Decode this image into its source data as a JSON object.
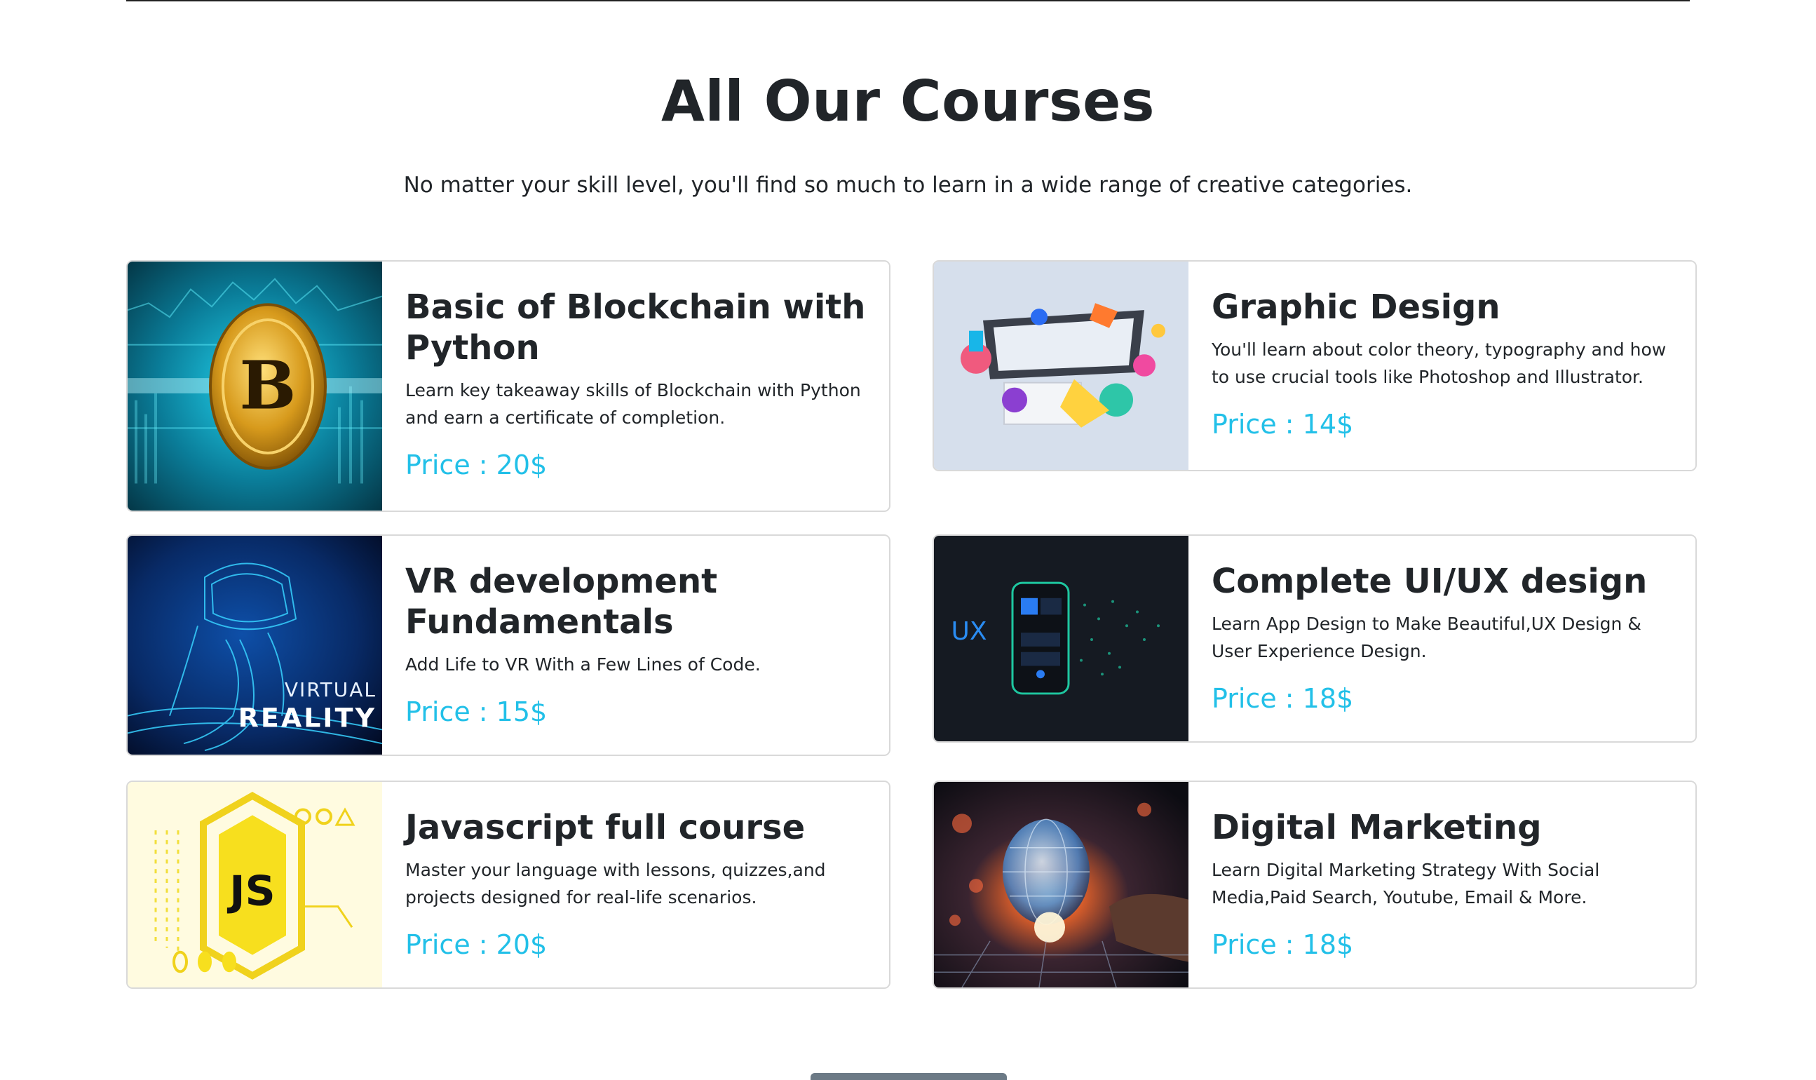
{
  "section": {
    "title": "All Our Courses",
    "subtitle": "No matter your skill level, you'll find so much to learn in a wide range of creative categories."
  },
  "accent_color": "#22c0e8",
  "courses": [
    {
      "title": "Basic of Blockchain with Python",
      "description": "Learn key takeaway skills of Blockchain with Python and earn a certificate of completion.",
      "price": "Price : 20$",
      "image_icon": "bitcoin-image",
      "image_text": "B"
    },
    {
      "title": "Graphic Design",
      "description": "You'll learn about color theory, typography and how to use crucial tools like Photoshop and Illustrator.",
      "price": "Price : 14$",
      "image_icon": "graphic-design-image"
    },
    {
      "title": "VR development Fundamentals",
      "description": "Add Life to VR With a Few Lines of Code.",
      "price": "Price : 15$",
      "image_icon": "virtual-reality-image",
      "image_text_1": "VIRTUAL",
      "image_text_2": "REALITY"
    },
    {
      "title": "Complete UI/UX design",
      "description": "Learn App Design to Make Beautiful,UX Design & User Experience Design.",
      "price": "Price : 18$",
      "image_icon": "ux-design-image",
      "image_text": "UX"
    },
    {
      "title": "Javascript full course",
      "description": "Master your language with lessons, quizzes,and projects designed for real-life scenarios.",
      "price": "Price : 20$",
      "image_icon": "javascript-image",
      "image_text": "JS"
    },
    {
      "title": "Digital Marketing",
      "description": "Learn Digital Marketing Strategy With Social Media,Paid Search, Youtube, Email & More.",
      "price": "Price : 18$",
      "image_icon": "digital-marketing-image"
    }
  ]
}
